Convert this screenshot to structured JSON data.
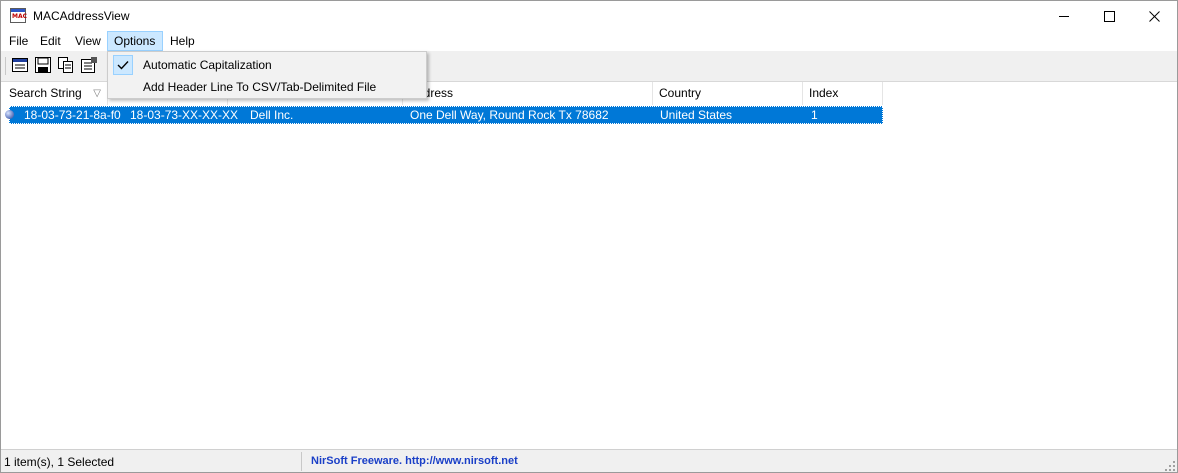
{
  "window": {
    "title": "MACAddressView",
    "icon_text": "MAC"
  },
  "menu": {
    "items": [
      {
        "label": "File",
        "open": false
      },
      {
        "label": "Edit",
        "open": false
      },
      {
        "label": "View",
        "open": false
      },
      {
        "label": "Options",
        "open": true
      },
      {
        "label": "Help",
        "open": false
      }
    ]
  },
  "toolbar": {
    "buttons": [
      "html-report-icon",
      "save-icon",
      "copy-icon",
      "properties-icon"
    ]
  },
  "options_menu": {
    "items": [
      {
        "label": "Automatic Capitalization",
        "checked": true
      },
      {
        "label": "Add Header Line To CSV/Tab-Delimited File",
        "checked": false
      }
    ]
  },
  "list": {
    "columns": [
      {
        "label": "Search String"
      },
      {
        "label": ""
      },
      {
        "label": ""
      },
      {
        "label": "Address"
      },
      {
        "label": "Country"
      },
      {
        "label": "Index"
      }
    ],
    "rows": [
      {
        "search_string": "18-03-73-21-8a-f0",
        "mac_prefix": "18-03-73-XX-XX-XX",
        "company": "Dell Inc.",
        "address": "One Dell Way, Round Rock  Tx  78682",
        "country": "United States",
        "index": "1",
        "selected": true
      }
    ]
  },
  "status": {
    "items_text": "1 item(s), 1 Selected",
    "link_text": "NirSoft Freeware.  http://www.nirsoft.net"
  },
  "colors": {
    "selection": "#0078d7",
    "menu_highlight": "#cce8ff",
    "link": "#1a3fc7"
  }
}
